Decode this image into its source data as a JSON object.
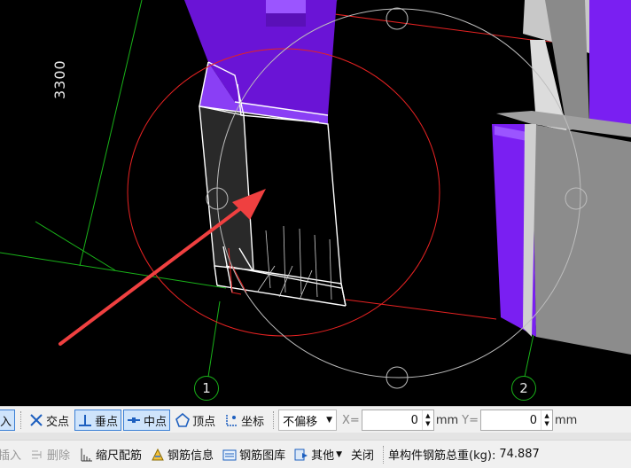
{
  "viewport": {
    "dimension_label": "3300",
    "axis_labels": [
      "1",
      "2"
    ]
  },
  "snap_toolbar": {
    "insert_label": "入",
    "intersection_label": "交点",
    "perpendicular_label": "垂点",
    "midpoint_label": "中点",
    "vertex_label": "顶点",
    "coordinate_label": "坐标",
    "offset_select": "不偏移",
    "x_label": "X=",
    "x_value": "0",
    "x_unit": "mm",
    "y_label": "Y=",
    "y_value": "0",
    "y_unit": "mm"
  },
  "command_toolbar": {
    "insert_label": "插入",
    "delete_label": "删除",
    "scale_rebar_label": "缩尺配筋",
    "rebar_info_label": "钢筋信息",
    "rebar_library_label": "钢筋图库",
    "other_label": "其他",
    "close_label": "关闭",
    "total_weight_label": "单构件钢筋总重(kg):",
    "total_weight_value": "74.887"
  },
  "colors": {
    "wall_purple": "#7a1ff2",
    "highlight_red": "#e62222",
    "axis_green": "#19b219",
    "active_button_bg": "#cfe4fb"
  }
}
